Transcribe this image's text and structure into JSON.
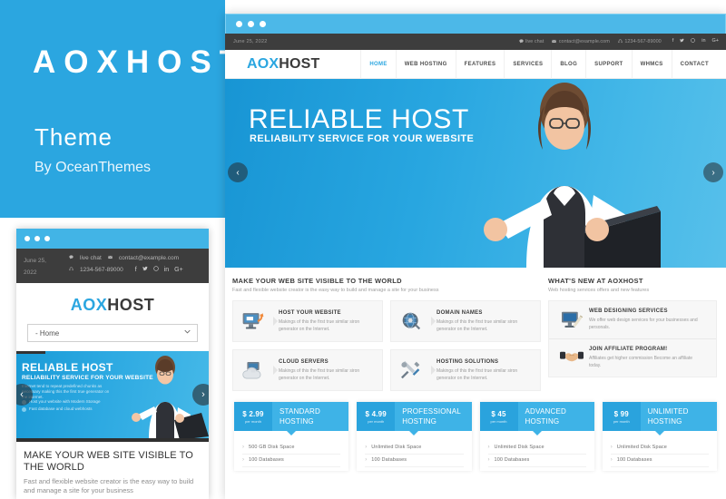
{
  "brand": {
    "title": "AOXHOST",
    "theme_label": "Theme",
    "author_label": "By OceanThemes",
    "accent_color": "#2ba6e0"
  },
  "site": {
    "logo_prefix": "AOX",
    "logo_suffix": "HOST",
    "date": "June 25, 2022",
    "live_chat": "live chat",
    "email": "contact@example.com",
    "phone": "1234-567-89000",
    "social": [
      "f",
      "t",
      "p",
      "in",
      "G+"
    ]
  },
  "nav": {
    "items": [
      {
        "label": "HOME",
        "active": true
      },
      {
        "label": "WEB HOSTING",
        "active": false
      },
      {
        "label": "FEATURES",
        "active": false
      },
      {
        "label": "SERVICES",
        "active": false
      },
      {
        "label": "BLOG",
        "active": false
      },
      {
        "label": "SUPPORT",
        "active": false
      },
      {
        "label": "WHMCS",
        "active": false
      },
      {
        "label": "CONTACT",
        "active": false
      }
    ]
  },
  "hero": {
    "title": "RELIABLE HOST",
    "subtitle": "RELIABILITY SERVICE FOR YOUR WEBSITE",
    "paragraph": "Internet tend to repeat predefined chunks as necessary making this the first true generator on the internet.",
    "feature_1": "Host your website with Modern Storage",
    "feature_2": "Fast database and cloud webhosts",
    "arrow_left": "‹",
    "arrow_right": "›"
  },
  "services": {
    "heading": "MAKE YOUR WEB SITE VISIBLE TO THE WORLD",
    "subheading": "Fast and flexible website creator is the easy way to build and manage a site for your business",
    "cards": [
      {
        "title": "HOST YOUR WEBSITE",
        "text": "Makings of this the first true similar siron generator on the Internet.",
        "icon": "monitor-upload-icon"
      },
      {
        "title": "DOMAIN NAMES",
        "text": "Makings of this the first true similar siron generator on the Internet.",
        "icon": "globe-disc-icon"
      },
      {
        "title": "CLOUD SERVERS",
        "text": "Makings of this the first true similar siron generator on the Internet.",
        "icon": "cloud-server-icon"
      },
      {
        "title": "HOSTING SOLUTIONS",
        "text": "Makings of this the first true similar siron generator on the Internet.",
        "icon": "tools-wrench-icon"
      }
    ]
  },
  "news": {
    "heading": "WHAT'S NEW AT AOXHOST",
    "subheading": "Web hosting services offers and new features",
    "items": [
      {
        "title": "WEB DESIGNING SERVICES",
        "text": "We offer web design services for your businesses and personals.",
        "icon": "monitor-pencil-icon"
      },
      {
        "title": "JOIN AFFILIATE PROGRAM!",
        "text": "Affiliates get higher commission Become an affiliate today.",
        "icon": "handshake-icon"
      }
    ]
  },
  "pricing": {
    "plans": [
      {
        "amount": "$ 2.99",
        "per": "per month",
        "name": "STANDARD HOSTING",
        "features": [
          "500 GB Disk Space",
          "100 Databases"
        ]
      },
      {
        "amount": "$ 4.99",
        "per": "per month",
        "name": "PROFESSIONAL HOSTING",
        "features": [
          "Unlimited Disk Space",
          "100 Databases"
        ]
      },
      {
        "amount": "$ 45",
        "per": "per month",
        "name": "ADVANCED HOSTING",
        "features": [
          "Unlimited Disk Space",
          "100 Databases"
        ]
      },
      {
        "amount": "$ 99",
        "per": "per month",
        "name": "UNLIMITED HOSTING",
        "features": [
          "Unlimited Disk Space",
          "100 Databases"
        ]
      }
    ]
  },
  "mobile": {
    "menu_value": "- Home",
    "chevron": "⌄",
    "body_heading": "MAKE YOUR WEB SITE VISIBLE TO THE WORLD",
    "body_sub": "Fast and flexible website creator is the easy way to build and manage a site for your business"
  }
}
